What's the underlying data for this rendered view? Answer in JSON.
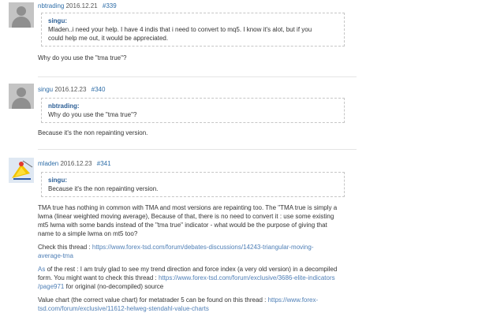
{
  "posts": [
    {
      "user": "nbtrading",
      "date": "2016.12.21",
      "number": "#339",
      "quote": {
        "author": "singu:",
        "lines": [
          "Mladen..i need your help. I have 4 indis that i need to convert to mq5.  I know it's alot, but if you",
          "could help me out, it would be appreciated."
        ]
      },
      "text": "Why do you use the \"tma true\"?"
    },
    {
      "user": "singu",
      "date": "2016.12.23",
      "number": "#340",
      "quote": {
        "author": "nbtrading:",
        "lines": [
          "Why do you use the \"tma true\"?"
        ]
      },
      "text": "Because it's the non repainting version."
    },
    {
      "user": "mladen",
      "date": "2016.12.23",
      "number": "#341",
      "quote": {
        "author": "singu:",
        "lines": [
          "Because it's the non repainting version."
        ]
      },
      "para1": [
        "TMA true has nothing in common with TMA and most versions are repainting too. The \"TMA true is simply a",
        "lwma (linear weighted moving average), Because of that, there is no need to convert it : use some existing",
        "mt5 lwma with some bands instead of the \"tma true\" indicator - what would be the purpose of giving that",
        "name to a simple lwma on mt5 too?"
      ],
      "check": {
        "prefix": "Check this thread : ",
        "link_line1": "https://www.forex-tsd.com/forum/debates-discussions/14243-triangular-moving-",
        "link_line2": "average-tma"
      },
      "rest": {
        "as": "As",
        "line1": " of the rest : I am truly glad to see my trend direction and force index (a very old version) in a decompiled",
        "line2_prefix": "form. You might want to check this thread : ",
        "line2_link": "https://www.forex-tsd.com/forum/exclusive/3686-elite-indicators",
        "line3_link": "/page971",
        "line3_suffix": " for original (no-decompiled) source"
      },
      "value": {
        "line1_prefix": "Value chart (the correct value chart) for metatrader 5 can be found on this thread : ",
        "line1_link": "https://www.forex-",
        "line2_link": "tsd.com/forum/exclusive/11612-helweg-stendahl-value-charts"
      }
    }
  ]
}
